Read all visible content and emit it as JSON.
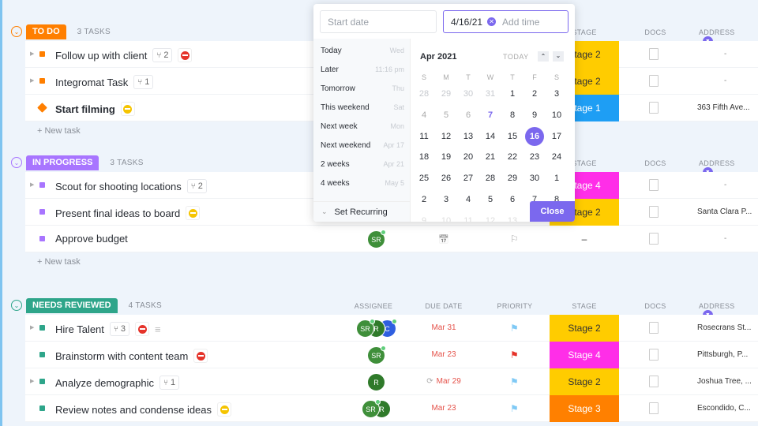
{
  "columns": {
    "assignee": "ASSIGNEE",
    "due_date": "DUE DATE",
    "priority": "PRIORITY",
    "stage": "STAGE",
    "docs": "DOCS",
    "address": "ADDRESS"
  },
  "new_task_label": "+ New task",
  "groups": [
    {
      "name": "TO DO",
      "count": "3 TASKS",
      "color": "#ff7f00",
      "tasks": [
        {
          "name": "Follow up with client",
          "subtasks": "2",
          "blocker": "red",
          "expand": true,
          "stage": "Stage 2",
          "stage_color": "#ffcc00",
          "address": "-"
        },
        {
          "name": "Integromat Task",
          "subtasks": "1",
          "expand": true,
          "stage": "Stage 2",
          "stage_color": "#ffcc00",
          "address": "-"
        },
        {
          "name": "Start filming",
          "blocker": "yellow",
          "shape": "diamond",
          "bold": true,
          "stage": "Stage 1",
          "stage_color": "#1e9ef4",
          "stage_text": "#fff",
          "address": "363 Fifth Ave..."
        }
      ]
    },
    {
      "name": "IN PROGRESS",
      "count": "3 TASKS",
      "color": "#a875ff",
      "tasks": [
        {
          "name": "Scout for shooting locations",
          "subtasks": "2",
          "expand": true,
          "stage": "Stage 4",
          "stage_color": "#ff2ee8",
          "stage_text": "#fff",
          "address": "-"
        },
        {
          "name": "Present final ideas to board",
          "blocker": "yellow",
          "stage": "Stage 2",
          "stage_color": "#ffcc00",
          "address": "Santa Clara P..."
        },
        {
          "name": "Approve budget",
          "assignees": [
            {
              "initials": "SR",
              "color": "#3f8f3a",
              "online": true
            }
          ],
          "due_icon": "calendar-icon",
          "priority_icon": "empty-flag",
          "stage": "–",
          "address": "-"
        }
      ]
    },
    {
      "name": "NEEDS REVIEWED",
      "count": "4 TASKS",
      "color": "#2ea58a",
      "tasks": [
        {
          "name": "Hire Talent",
          "subtasks": "3",
          "blocker": "red",
          "has_description": true,
          "expand": true,
          "assignees": [
            {
              "initials": "SR",
              "color": "#3f8f3a",
              "online": true
            },
            {
              "initials": "R",
              "color": "#2f7a2a"
            },
            {
              "initials": "C",
              "color": "#2f5fe0",
              "online": true
            }
          ],
          "due": "Mar 31",
          "priority": "#7fc9f5",
          "stage": "Stage 2",
          "stage_color": "#ffcc00",
          "address": "Rosecrans St..."
        },
        {
          "name": "Brainstorm with content team",
          "blocker": "red",
          "assignees": [
            {
              "initials": "SR",
              "color": "#3f8f3a",
              "online": true
            }
          ],
          "due": "Mar 23",
          "priority": "#e5332a",
          "stage": "Stage 4",
          "stage_color": "#ff2ee8",
          "stage_text": "#fff",
          "address": "Pittsburgh, P..."
        },
        {
          "name": "Analyze demographic",
          "subtasks": "1",
          "expand": true,
          "assignees": [
            {
              "initials": "R",
              "color": "#2f7a2a"
            }
          ],
          "due": "Mar 29",
          "recurring": true,
          "priority": "#7fc9f5",
          "stage": "Stage 2",
          "stage_color": "#ffcc00",
          "address": "Joshua Tree, ..."
        },
        {
          "name": "Review notes and condense ideas",
          "blocker": "yellow",
          "assignees": [
            {
              "initials": "SR",
              "color": "#3f8f3a",
              "online": true
            },
            {
              "initials": "R",
              "color": "#2f7a2a"
            }
          ],
          "due": "Mar 23",
          "priority": "#7fc9f5",
          "stage": "Stage 3",
          "stage_color": "#ff8000",
          "stage_text": "#fff",
          "address": "Escondido, C..."
        }
      ]
    }
  ],
  "datepicker": {
    "start_placeholder": "Start date",
    "due_value": "4/16/21",
    "time_placeholder": "Add time",
    "quick": [
      [
        "Today",
        "Wed"
      ],
      [
        "Later",
        "11:16 pm"
      ],
      [
        "Tomorrow",
        "Thu"
      ],
      [
        "This weekend",
        "Sat"
      ],
      [
        "Next week",
        "Mon"
      ],
      [
        "Next weekend",
        "Apr 17"
      ],
      [
        "2 weeks",
        "Apr 21"
      ],
      [
        "4 weeks",
        "May 5"
      ]
    ],
    "set_recurring": "Set Recurring",
    "month": "Apr 2021",
    "today_label": "TODAY",
    "weekdays": [
      "S",
      "M",
      "T",
      "W",
      "T",
      "F",
      "S"
    ],
    "weeks": [
      [
        "28",
        "29",
        "30",
        "31",
        "1",
        "2",
        "3"
      ],
      [
        "4",
        "5",
        "6",
        "7",
        "8",
        "9",
        "10"
      ],
      [
        "11",
        "12",
        "13",
        "14",
        "15",
        "16",
        "17"
      ],
      [
        "18",
        "19",
        "20",
        "21",
        "22",
        "23",
        "24"
      ],
      [
        "25",
        "26",
        "27",
        "28",
        "29",
        "30",
        "1"
      ],
      [
        "2",
        "3",
        "4",
        "5",
        "6",
        "7",
        "8"
      ],
      [
        "9",
        "10",
        "11",
        "12",
        "13",
        "14",
        "15"
      ]
    ],
    "today": "7",
    "selected": "16",
    "accent": "#7b68ee",
    "close_label": "Close"
  }
}
